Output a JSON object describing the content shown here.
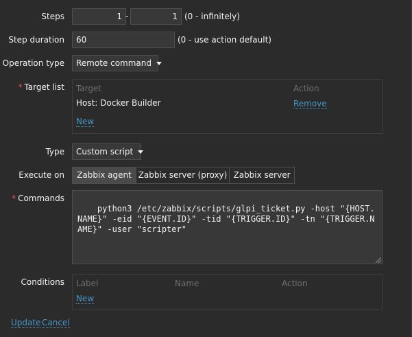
{
  "steps": {
    "label": "Steps",
    "from": "1",
    "separator": "-",
    "to": "1",
    "hint": "(0 - infinitely)"
  },
  "step_duration": {
    "label": "Step duration",
    "value": "60",
    "hint": "(0 - use action default)"
  },
  "operation_type": {
    "label": "Operation type",
    "selected": "Remote command"
  },
  "target_list": {
    "required_mark": "*",
    "label": "Target list",
    "col_target": "Target",
    "col_action": "Action",
    "rows": [
      {
        "target": "Host: Docker Builder",
        "action": "Remove"
      }
    ],
    "new_link": "New"
  },
  "type": {
    "label": "Type",
    "selected": "Custom script"
  },
  "execute_on": {
    "label": "Execute on",
    "options": [
      "Zabbix agent",
      "Zabbix server (proxy)",
      "Zabbix server"
    ],
    "selected_index": 0
  },
  "commands": {
    "required_mark": "*",
    "label": "Commands",
    "value": "python3 /etc/zabbix/scripts/glpi_ticket.py -host \"{HOST.NAME}\" -eid \"{EVENT.ID}\" -tid \"{TRIGGER.ID}\" -tn \"{TRIGGER.NAME}\" -user \"scripter\""
  },
  "conditions": {
    "label": "Conditions",
    "col_label": "Label",
    "col_name": "Name",
    "col_action": "Action",
    "new_link": "New"
  },
  "footer": {
    "update": "Update",
    "cancel": "Cancel"
  },
  "colors": {
    "background": "#2b2b2b",
    "link": "#4796c4",
    "required": "#e45959",
    "input_bg": "#383838"
  }
}
